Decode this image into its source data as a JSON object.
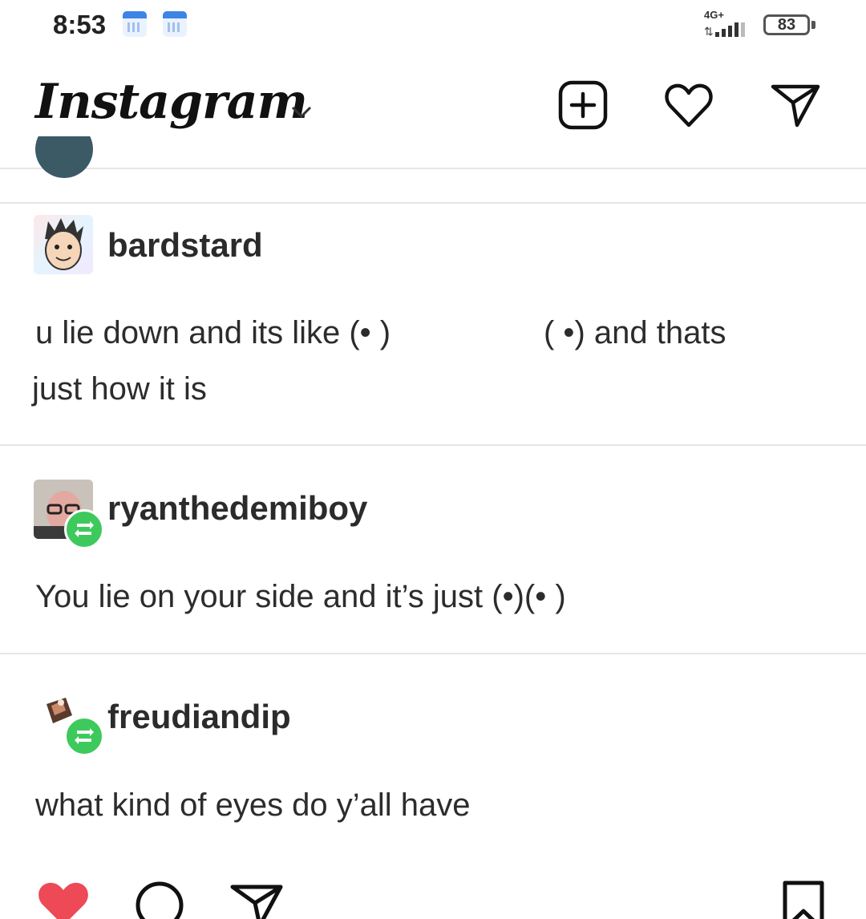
{
  "status_bar": {
    "time": "8:53",
    "network_type": "4G+",
    "battery_level": "83"
  },
  "header": {
    "logo_text": "Instagram"
  },
  "posts": [
    {
      "username": "bardstard",
      "line1_a": "u lie down and its like (• )",
      "line1_b": "( •)  and thats",
      "line2": "just how it is"
    },
    {
      "username": "ryanthedemiboy",
      "text": "You lie on your side and it’s just (•)(• )"
    },
    {
      "username": "freudiandip",
      "text": "what kind of eyes do y’all have"
    }
  ],
  "actions": {
    "liked": true,
    "like_color": "#ed4956"
  },
  "colors": {
    "reblog_badge": "#3ec95c"
  }
}
